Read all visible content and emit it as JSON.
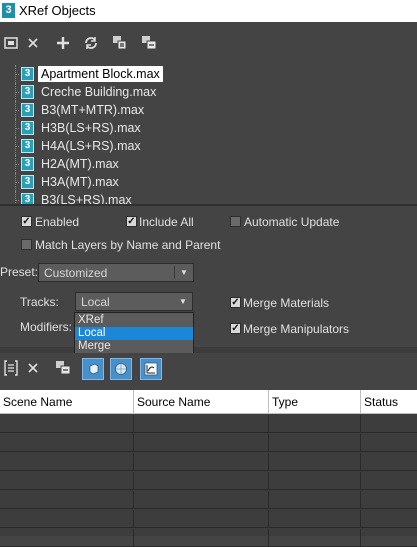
{
  "window": {
    "title": "XRef Objects",
    "app_icon": "3ds-max-icon"
  },
  "toolbar_top": {
    "buttons": [
      {
        "name": "add-xref-object-icon"
      },
      {
        "name": "remove-icon",
        "glyph": "✕"
      },
      {
        "name": "add-icon",
        "glyph": "+"
      },
      {
        "name": "refresh-icon"
      },
      {
        "name": "convert-selected-icon"
      },
      {
        "name": "merge-in-scene-icon"
      }
    ]
  },
  "files": [
    {
      "label": "Apartment Block.max",
      "selected": true
    },
    {
      "label": "Creche Building.max"
    },
    {
      "label": "B3(MT+MTR).max"
    },
    {
      "label": "H3B(LS+RS).max"
    },
    {
      "label": "H4A(LS+RS).max"
    },
    {
      "label": "H2A(MT).max"
    },
    {
      "label": "H3A(MT).max"
    },
    {
      "label": "B3(LS+RS).max"
    }
  ],
  "file_icon_glyph": "3",
  "options": {
    "enabled": {
      "label": "Enabled",
      "checked": true
    },
    "include_all": {
      "label": "Include All",
      "checked": true
    },
    "automatic_update": {
      "label": "Automatic Update",
      "checked": false
    },
    "match_layers": {
      "label": "Match Layers by Name and Parent",
      "checked": false
    },
    "preset": {
      "label": "Preset:",
      "value": "Customized"
    },
    "tracks": {
      "label": "Tracks:",
      "value": "Local",
      "options": [
        "XRef",
        "Local",
        "Merge"
      ],
      "highlighted": "Local"
    },
    "modifiers": {
      "label": "Modifiers:"
    },
    "merge_materials": {
      "label": "Merge Materials",
      "checked": true
    },
    "merge_manipulators": {
      "label": "Merge Manipulators",
      "checked": true
    }
  },
  "toolbar_bottom": {
    "buttons": [
      {
        "name": "list-icon"
      },
      {
        "name": "remove-entity-icon",
        "glyph": "✕"
      },
      {
        "name": "merge-entity-icon"
      },
      {
        "name": "display-objects-icon",
        "active": true
      },
      {
        "name": "display-materials-icon",
        "active": true
      },
      {
        "name": "display-controllers-icon",
        "active": true
      }
    ]
  },
  "table": {
    "columns": [
      "Scene Name",
      "Source Name",
      "Type",
      "Status"
    ],
    "rows": 7
  },
  "colors": {
    "panel": "#444444",
    "selection": "#1c87d8",
    "active_button": "#4a90c8"
  }
}
